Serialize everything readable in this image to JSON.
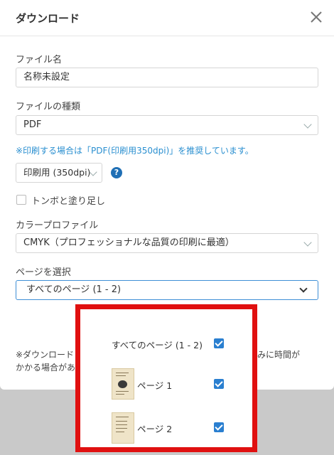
{
  "dialog": {
    "title": "ダウンロード"
  },
  "form": {
    "filename_label": "ファイル名",
    "filename_value": "名称未設定",
    "filetype_label": "ファイルの種類",
    "filetype_value": "PDF",
    "print_note": "※印刷する場合は「PDF(印刷用350dpi)」を推奨しています。",
    "quality_value": "印刷用 (350dpi)",
    "help_glyph": "?",
    "trim_label": "トンボと塗り足し",
    "color_profile_label": "カラープロファイル",
    "color_profile_value": "CMYK（プロフェッショナルな品質の印刷に最適）",
    "page_select_label": "ページを選択",
    "page_select_value": "すべてのページ (1 - 2)",
    "footnote_left_1": "※ダウンロード",
    "footnote_left_2": "かかる場合があ",
    "footnote_right": "込みに時間が"
  },
  "page_options": {
    "all_pages": "すべてのページ (1 - 2)",
    "page1": "ページ 1",
    "page2": "ページ 2"
  },
  "colors": {
    "accent": "#2a7fd0",
    "highlight_border": "#e01010",
    "note_text": "#2a8fd0"
  }
}
